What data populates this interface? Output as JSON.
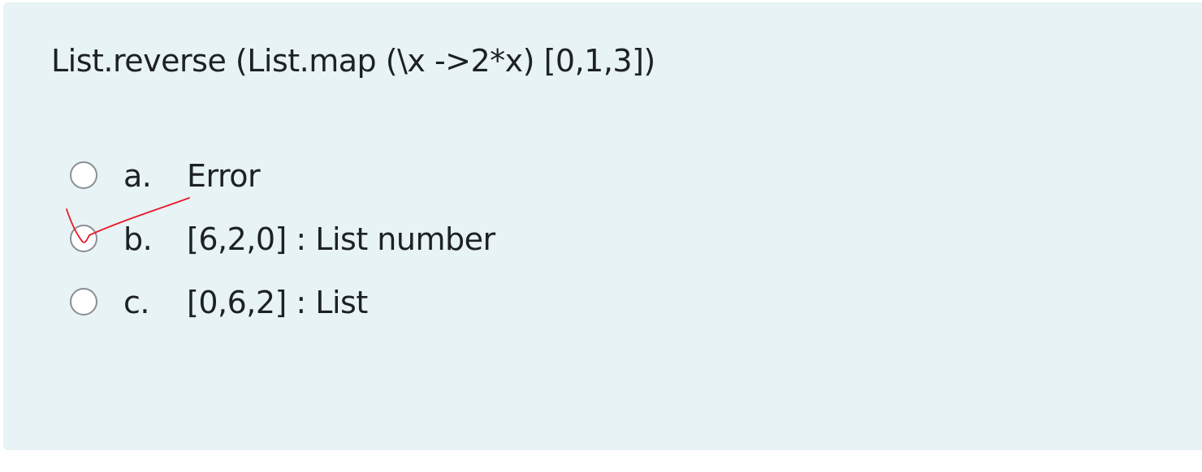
{
  "question": {
    "text": "List.reverse (List.map (\\x ->2*x) [0,1,3])"
  },
  "answers": [
    {
      "letter": "a.",
      "text": "Error"
    },
    {
      "letter": "b.",
      "text": "[6,2,0] : List number"
    },
    {
      "letter": "c.",
      "text": "[0,6,2] : List"
    }
  ],
  "colors": {
    "panel_background": "#e7f3f5",
    "text": "#1d2125",
    "radio_border": "#8a8f94",
    "annotation_mark": "#e8182a"
  },
  "annotation": {
    "icon": "red-checkmark-icon"
  }
}
